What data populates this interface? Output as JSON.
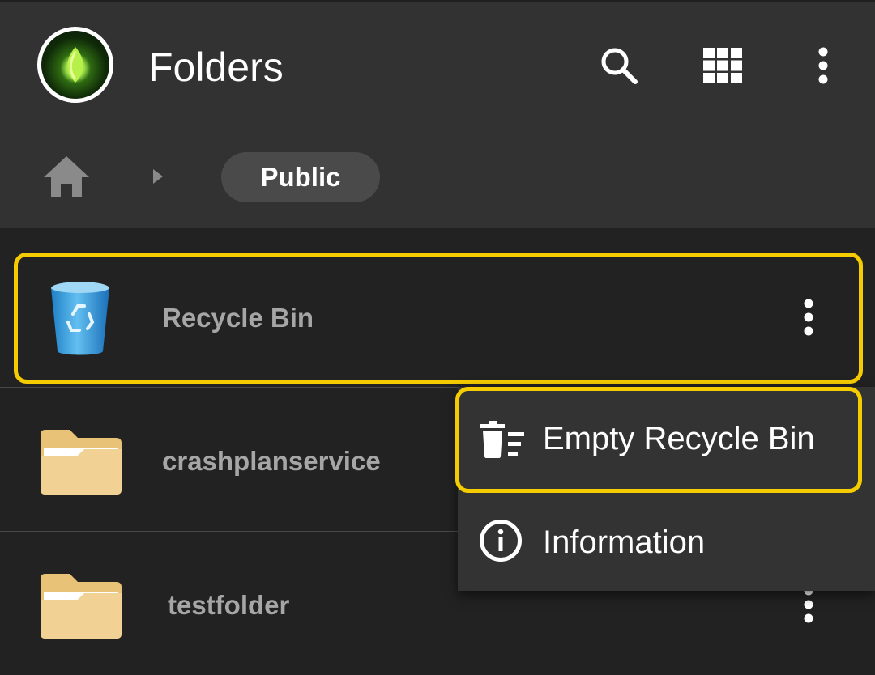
{
  "header": {
    "title": "Folders",
    "icons": {
      "avatar": "avatar",
      "search": "search-icon",
      "view": "grid-view-icon",
      "overflow": "more-vert-icon"
    }
  },
  "breadcrumb": {
    "home_icon": "home-icon",
    "separator_icon": "chevron-right-icon",
    "current": "Public"
  },
  "list": {
    "items": [
      {
        "name": "Recycle Bin",
        "icon": "recycle-bin-icon"
      },
      {
        "name": "crashplanservice",
        "icon": "folder-icon"
      },
      {
        "name": "testfolder",
        "icon": "folder-icon"
      }
    ]
  },
  "context_menu": {
    "items": [
      {
        "label": "Empty Recycle Bin",
        "icon": "delete-sweep-icon"
      },
      {
        "label": "Information",
        "icon": "info-icon"
      }
    ]
  },
  "colors": {
    "appbar": "#323232",
    "background": "#222222",
    "highlight": "#f5cc00",
    "text_primary": "#ffffff",
    "text_secondary": "#a6a6a6"
  }
}
